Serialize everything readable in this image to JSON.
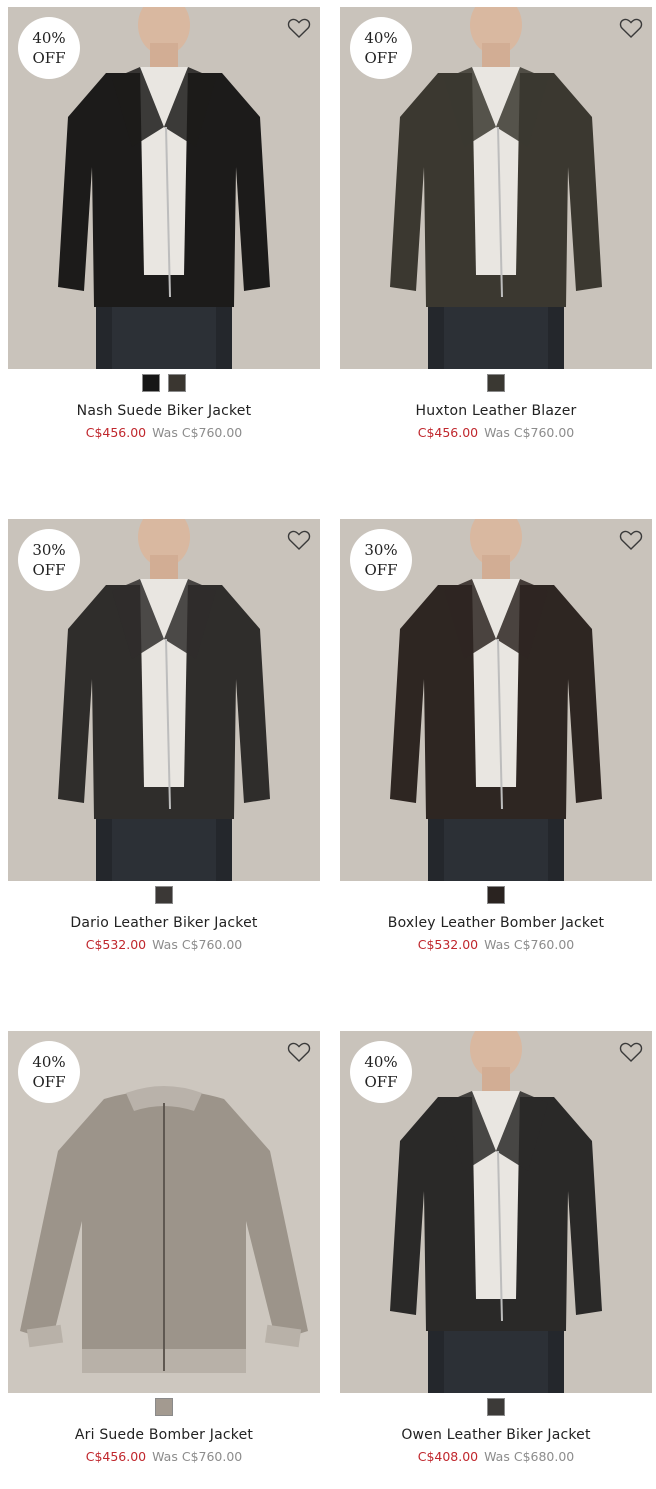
{
  "products": [
    {
      "discount_line1": "40%",
      "discount_line2": "OFF",
      "name": "Nash Suede Biker Jacket",
      "sale_price": "C$456.00",
      "was_label": "Was",
      "was_price": "C$760.00",
      "jacket_color": "#1c1b1a",
      "swatches": [
        "#161616",
        "#3a3630"
      ],
      "wishlist_icon": "heart-outline-icon"
    },
    {
      "discount_line1": "40%",
      "discount_line2": "OFF",
      "name": "Huxton Leather Blazer",
      "sale_price": "C$456.00",
      "was_label": "Was",
      "was_price": "C$760.00",
      "jacket_color": "#3b3830",
      "swatches": [
        "#3a3832"
      ],
      "wishlist_icon": "heart-outline-icon"
    },
    {
      "discount_line1": "30%",
      "discount_line2": "OFF",
      "name": "Dario Leather Biker Jacket",
      "sale_price": "C$532.00",
      "was_label": "Was",
      "was_price": "C$760.00",
      "jacket_color": "#2f2d2b",
      "swatches": [
        "#3b3836"
      ],
      "wishlist_icon": "heart-outline-icon"
    },
    {
      "discount_line1": "30%",
      "discount_line2": "OFF",
      "name": "Boxley Leather Bomber Jacket",
      "sale_price": "C$532.00",
      "was_label": "Was",
      "was_price": "C$760.00",
      "jacket_color": "#2e2622",
      "swatches": [
        "#2a2320"
      ],
      "wishlist_icon": "heart-outline-icon"
    },
    {
      "discount_line1": "40%",
      "discount_line2": "OFF",
      "name": "Ari Suede Bomber Jacket",
      "sale_price": "C$456.00",
      "was_label": "Was",
      "was_price": "C$760.00",
      "jacket_color": "#9c948a",
      "swatches": [
        "#a39a90"
      ],
      "wishlist_icon": "heart-outline-icon"
    },
    {
      "discount_line1": "40%",
      "discount_line2": "OFF",
      "name": "Owen Leather Biker Jacket",
      "sale_price": "C$408.00",
      "was_label": "Was",
      "was_price": "C$680.00",
      "jacket_color": "#2a2928",
      "swatches": [
        "#3c3a38"
      ],
      "wishlist_icon": "heart-outline-icon"
    }
  ],
  "colors": {
    "sale": "#c0272d",
    "was": "#8c8c8c",
    "photo_bg": "#c9c3bb"
  }
}
